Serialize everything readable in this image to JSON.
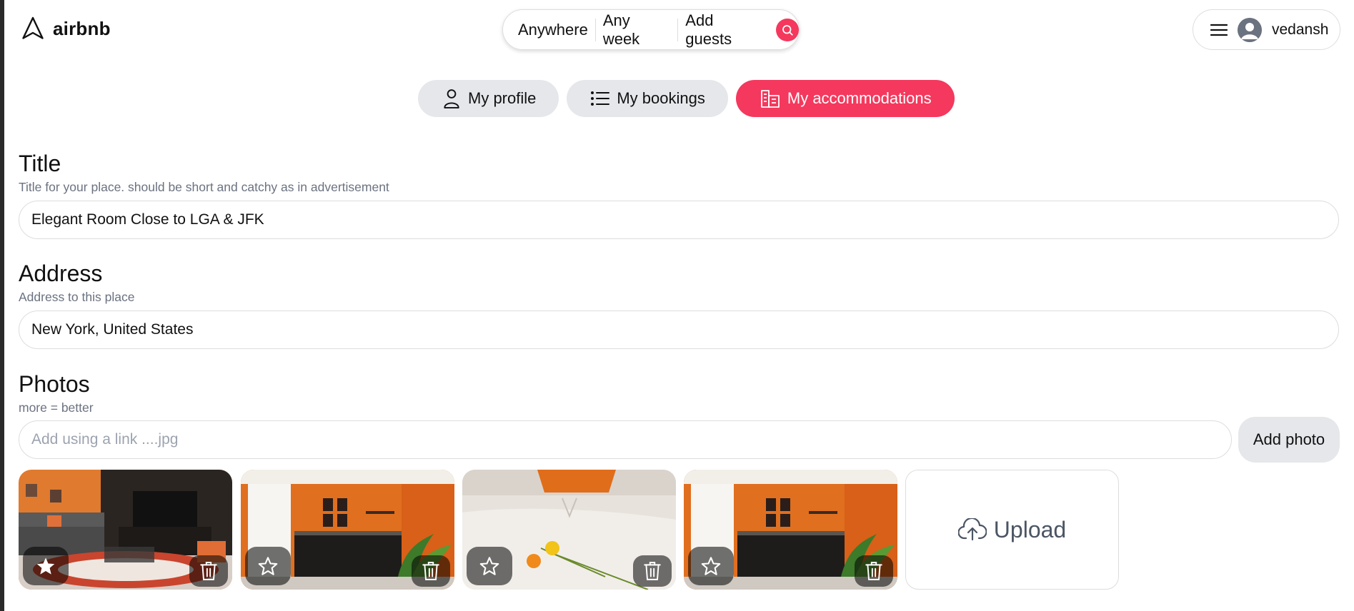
{
  "app": {
    "name": "airbnb"
  },
  "search": {
    "where": "Anywhere",
    "when": "Any week",
    "who": "Add guests"
  },
  "user": {
    "name": "vedansh"
  },
  "tabs": [
    {
      "label": "My profile",
      "icon": "user-icon",
      "active": false
    },
    {
      "label": "My bookings",
      "icon": "list-icon",
      "active": false
    },
    {
      "label": "My accommodations",
      "icon": "building-icon",
      "active": true
    }
  ],
  "form": {
    "title": {
      "label": "Title",
      "help": "Title for your place. should be short and catchy as in advertisement",
      "value": "Elegant Room Close to LGA & JFK"
    },
    "address": {
      "label": "Address",
      "help": "Address to this place",
      "value": "New York, United States"
    },
    "photos": {
      "label": "Photos",
      "help": "more = better",
      "link_placeholder": "Add using a link ....jpg",
      "add_button": "Add photo",
      "upload_label": "Upload",
      "items": [
        {
          "scene": "living room",
          "main": true
        },
        {
          "scene": "kitchenette",
          "main": false
        },
        {
          "scene": "bed with flowers",
          "main": false
        },
        {
          "scene": "kitchenette",
          "main": false
        }
      ]
    }
  },
  "colors": {
    "accent": "#f5385d",
    "tab_bg": "#e5e7eb",
    "border": "#dddddd",
    "muted_text": "#6b7280"
  }
}
